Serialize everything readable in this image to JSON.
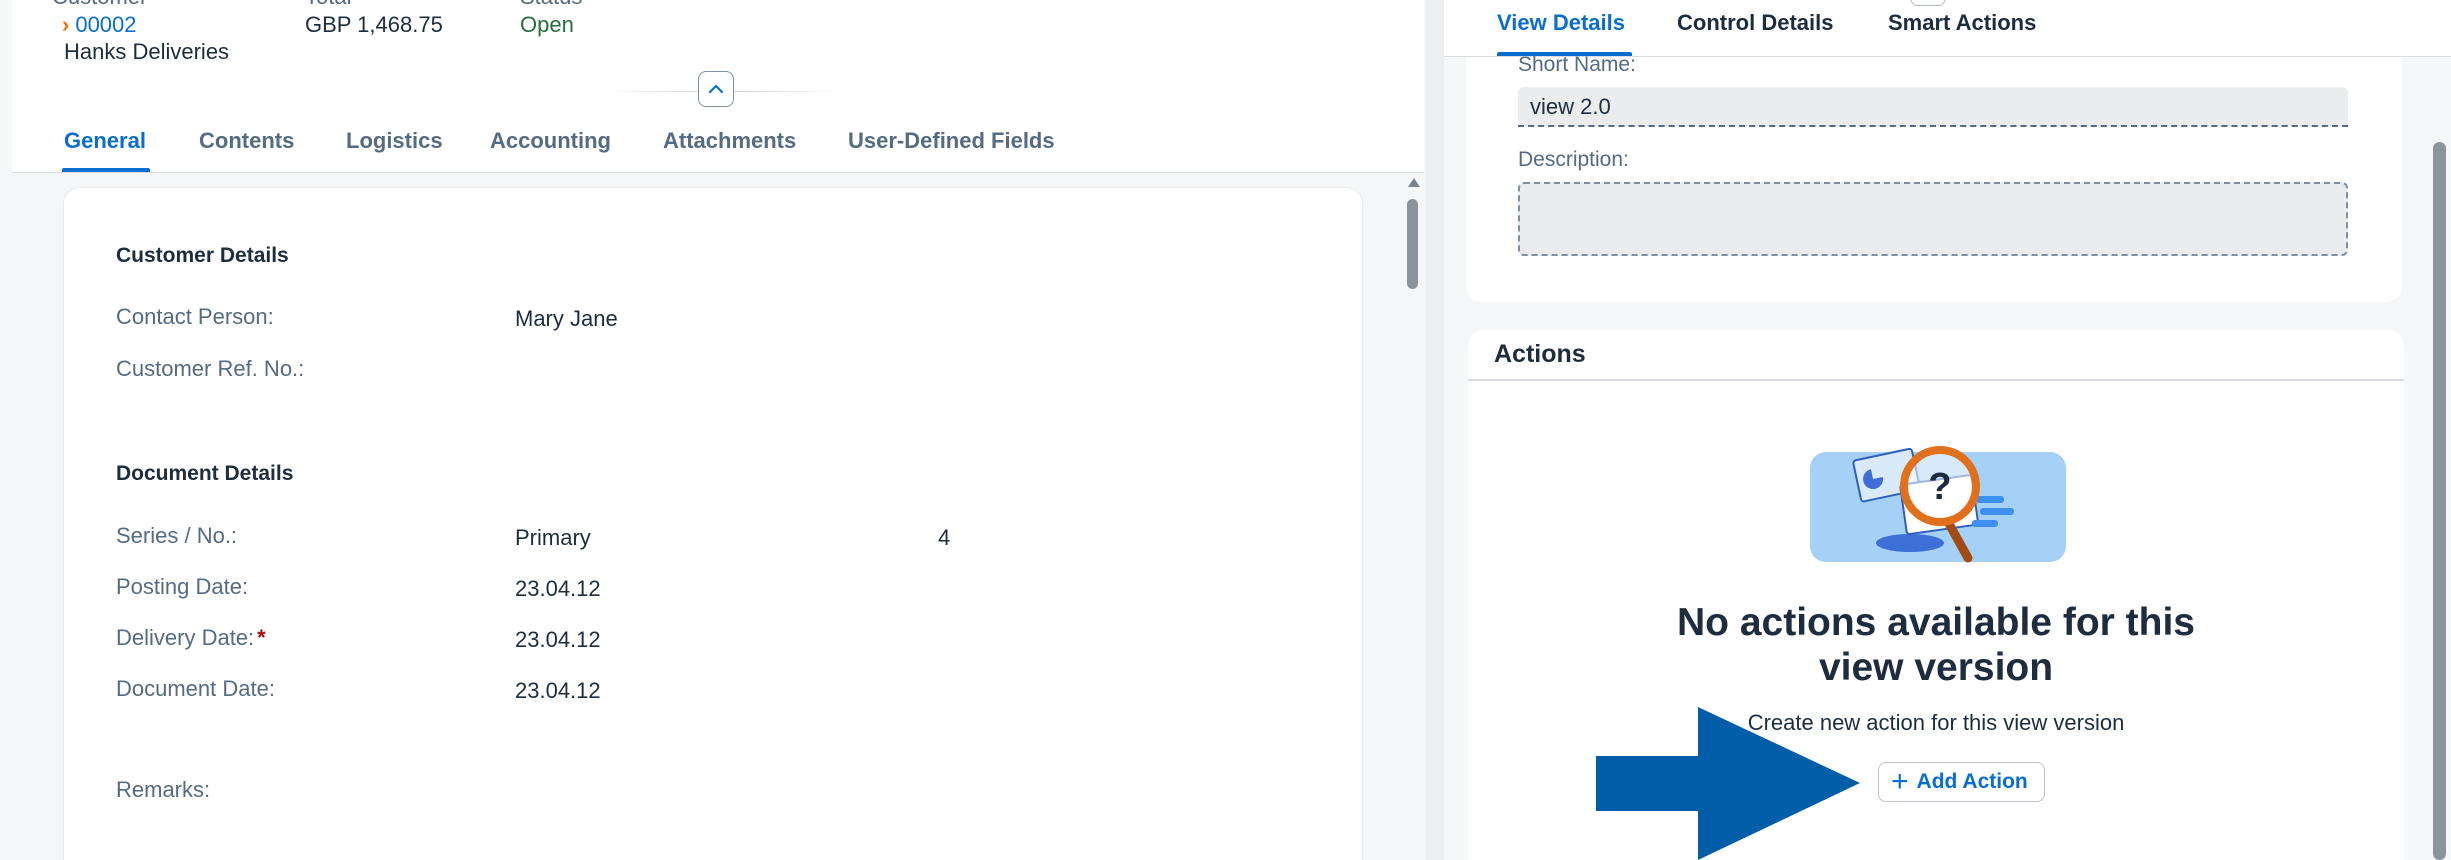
{
  "header": {
    "customer_label": "Customer",
    "customer_code": "00002",
    "customer_name": "Hanks Deliveries",
    "total_label": "Total",
    "total_value": "GBP 1,468.75",
    "status_label": "Status",
    "status_value": "Open"
  },
  "tabs": [
    {
      "label": "General",
      "active": true
    },
    {
      "label": "Contents"
    },
    {
      "label": "Logistics"
    },
    {
      "label": "Accounting"
    },
    {
      "label": "Attachments"
    },
    {
      "label": "User-Defined Fields"
    }
  ],
  "customer_details": {
    "title": "Customer Details",
    "contact_person_label": "Contact Person:",
    "contact_person_value": "Mary Jane",
    "customer_ref_label": "Customer Ref. No.:"
  },
  "document_details": {
    "title": "Document Details",
    "series_label": "Series / No.:",
    "series_value": "Primary",
    "series_number": "4",
    "posting_date_label": "Posting Date:",
    "posting_date_value": "23.04.12",
    "delivery_date_label": "Delivery Date:",
    "delivery_date_value": "23.04.12",
    "document_date_label": "Document Date:",
    "document_date_value": "23.04.12",
    "remarks_label": "Remarks:"
  },
  "right_panel": {
    "tabs": [
      "View Details",
      "Control Details",
      "Smart Actions"
    ],
    "active_tab": "View Details",
    "short_name_label": "Short Name:",
    "short_name_value": "view 2.0",
    "description_label": "Description:",
    "description_value": "",
    "actions_title": "Actions",
    "empty_title_line1": "No actions available for this",
    "empty_title_line2": "view version",
    "empty_subtitle": "Create new action for this view version",
    "add_action_label": "Add Action"
  },
  "colors": {
    "accent": "#0a6ed1",
    "status_positive": "#256f3a",
    "required": "#aa0808",
    "annotation_arrow": "#005ea8"
  },
  "icons": {
    "customer_chevron": "chevron-right-icon",
    "collapse": "chevron-up-icon",
    "add": "plus-icon",
    "empty_state": "magnifier-question-illustration",
    "annotation": "pointer-arrow"
  }
}
